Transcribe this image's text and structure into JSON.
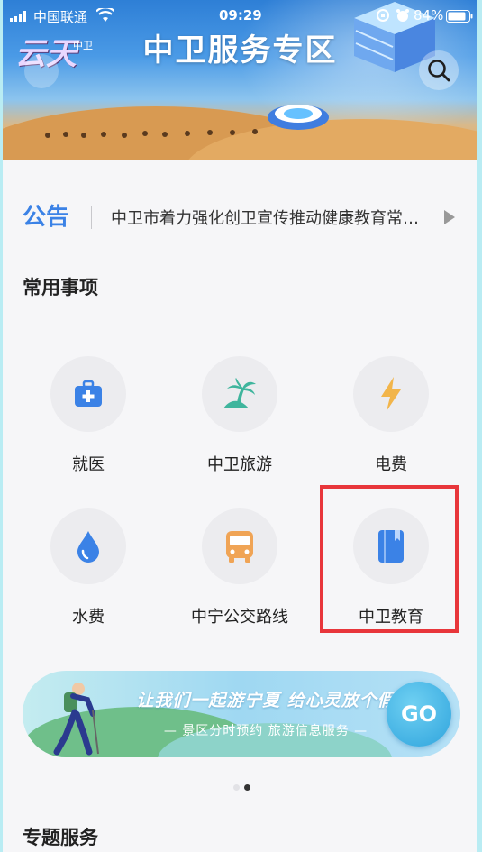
{
  "status_bar": {
    "carrier": "中国联通",
    "time": "09:29",
    "battery": "84%"
  },
  "header": {
    "title": "中卫服务专区",
    "logo_text": "云天",
    "logo_sub": "中卫"
  },
  "notice": {
    "label": "公告",
    "text": "中卫市着力强化创卫宣传推动健康教育常…"
  },
  "common": {
    "title": "常用事项",
    "items": [
      {
        "label": "就医",
        "icon": "medical-kit-icon",
        "color": "#3b82e6"
      },
      {
        "label": "中卫旅游",
        "icon": "palm-tree-icon",
        "color": "#3fb59d"
      },
      {
        "label": "电费",
        "icon": "lightning-icon",
        "color": "#f2b54a"
      },
      {
        "label": "水费",
        "icon": "water-drop-icon",
        "color": "#3b82e6"
      },
      {
        "label": "中宁公交路线",
        "icon": "bus-icon",
        "color": "#f0a455"
      },
      {
        "label": "中卫教育",
        "icon": "book-icon",
        "color": "#3b82e6"
      }
    ]
  },
  "promo": {
    "slogan": "让我们一起游宁夏 给心灵放个假",
    "sub": "— 景区分时预约 旅游信息服务 —",
    "go": "GO"
  },
  "carousel": {
    "count": 2,
    "active": 1
  },
  "topics": {
    "title": "专题服务"
  },
  "colors": {
    "accent": "#3b82e6",
    "highlight": "#e8363b"
  }
}
